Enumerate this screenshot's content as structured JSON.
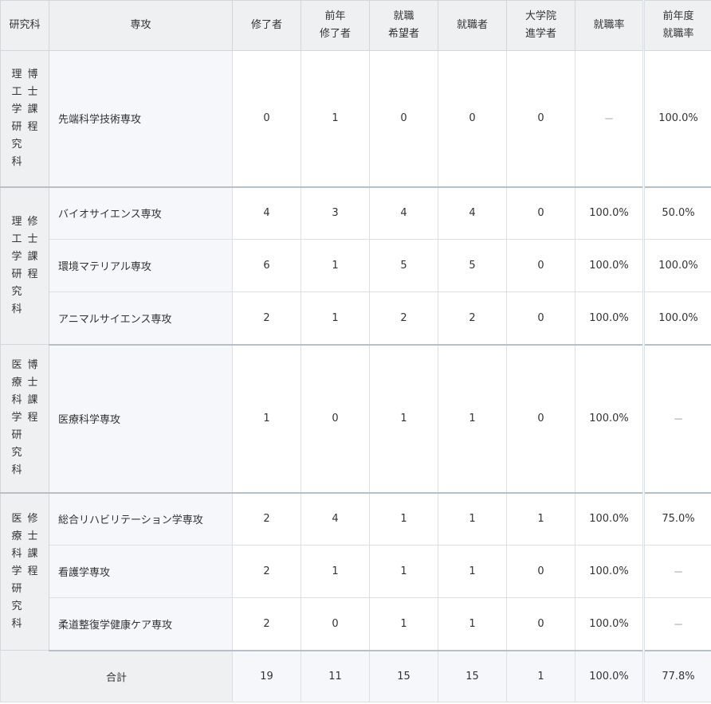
{
  "headers": {
    "graduate_school": "研究科",
    "major": "専攻",
    "completed": "修了者",
    "prev_completed_l1": "前年",
    "prev_completed_l2": "修了者",
    "job_seekers_l1": "就職",
    "job_seekers_l2": "希望者",
    "employed": "就職者",
    "grad_school_l1": "大学院",
    "grad_school_l2": "進学者",
    "employment_rate": "就職率",
    "prev_rate_l1": "前年度",
    "prev_rate_l2": "就職率"
  },
  "groups": [
    {
      "school_col1": "理工学研究科",
      "school_col2": "博士課程",
      "rows": [
        {
          "major": "先端科学技術専攻",
          "completed": "0",
          "prev_completed": "1",
          "job_seekers": "0",
          "employed": "0",
          "grad_school": "0",
          "rate": "－",
          "prev_rate": "100.0%"
        }
      ]
    },
    {
      "school_col1": "理工学研究科",
      "school_col2": "修士課程",
      "rows": [
        {
          "major": "バイオサイエンス専攻",
          "completed": "4",
          "prev_completed": "3",
          "job_seekers": "4",
          "employed": "4",
          "grad_school": "0",
          "rate": "100.0%",
          "prev_rate": "50.0%"
        },
        {
          "major": "環境マテリアル専攻",
          "completed": "6",
          "prev_completed": "1",
          "job_seekers": "5",
          "employed": "5",
          "grad_school": "0",
          "rate": "100.0%",
          "prev_rate": "100.0%"
        },
        {
          "major": "アニマルサイエンス専攻",
          "completed": "2",
          "prev_completed": "1",
          "job_seekers": "2",
          "employed": "2",
          "grad_school": "0",
          "rate": "100.0%",
          "prev_rate": "100.0%"
        }
      ]
    },
    {
      "school_col1": "医療科学研究科",
      "school_col2": "博士課程",
      "rows": [
        {
          "major": "医療科学専攻",
          "completed": "1",
          "prev_completed": "0",
          "job_seekers": "1",
          "employed": "1",
          "grad_school": "0",
          "rate": "100.0%",
          "prev_rate": "－"
        }
      ]
    },
    {
      "school_col1": "医療科学研究科",
      "school_col2": "修士課程",
      "rows": [
        {
          "major": "総合リハビリテーション学専攻",
          "completed": "2",
          "prev_completed": "4",
          "job_seekers": "1",
          "employed": "1",
          "grad_school": "1",
          "rate": "100.0%",
          "prev_rate": "75.0%"
        },
        {
          "major": "看護学専攻",
          "completed": "2",
          "prev_completed": "1",
          "job_seekers": "1",
          "employed": "1",
          "grad_school": "0",
          "rate": "100.0%",
          "prev_rate": "－"
        },
        {
          "major": "柔道整復学健康ケア専攻",
          "completed": "2",
          "prev_completed": "0",
          "job_seekers": "1",
          "employed": "1",
          "grad_school": "0",
          "rate": "100.0%",
          "prev_rate": "－"
        }
      ]
    }
  ],
  "total": {
    "label": "合計",
    "completed": "19",
    "prev_completed": "11",
    "job_seekers": "15",
    "employed": "15",
    "grad_school": "1",
    "rate": "100.0%",
    "prev_rate": "77.8%"
  }
}
